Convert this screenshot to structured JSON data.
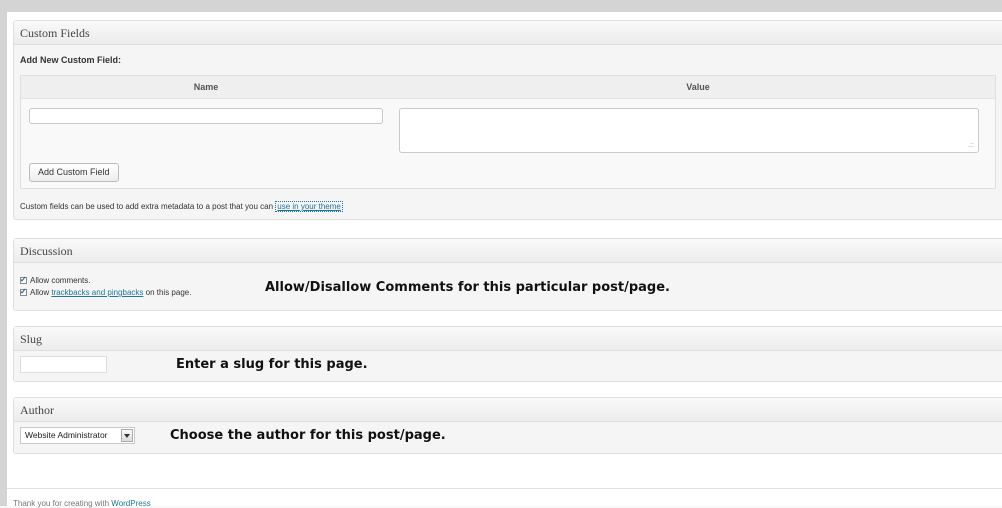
{
  "custom_fields": {
    "title": "Custom Fields",
    "add_new_label": "Add New Custom Field:",
    "col_name": "Name",
    "col_value": "Value",
    "name_input_value": "",
    "value_input_value": "",
    "add_button_label": "Add Custom Field",
    "help_text": "Custom fields can be used to add extra metadata to a post that you can ",
    "help_link": "use in your theme"
  },
  "discussion": {
    "title": "Discussion",
    "allow_comments_label": "Allow comments.",
    "allow_comments_checked": true,
    "allow_trackbacks_prefix": "Allow ",
    "allow_trackbacks_link": "trackbacks and pingbacks",
    "allow_trackbacks_suffix": " on this page.",
    "allow_trackbacks_checked": true,
    "callout": "Allow/Disallow Comments for this particular post/page."
  },
  "slug": {
    "title": "Slug",
    "value": "",
    "callout": "Enter a slug for this page."
  },
  "author": {
    "title": "Author",
    "selected": "Website Administrator",
    "callout": "Choose the author for this post/page."
  },
  "footer": {
    "text": "Thank you for creating with ",
    "link": "WordPress"
  },
  "colors": {
    "link": "#21759b",
    "panel_bg": "#f5f5f5",
    "border": "#dfdfdf"
  }
}
